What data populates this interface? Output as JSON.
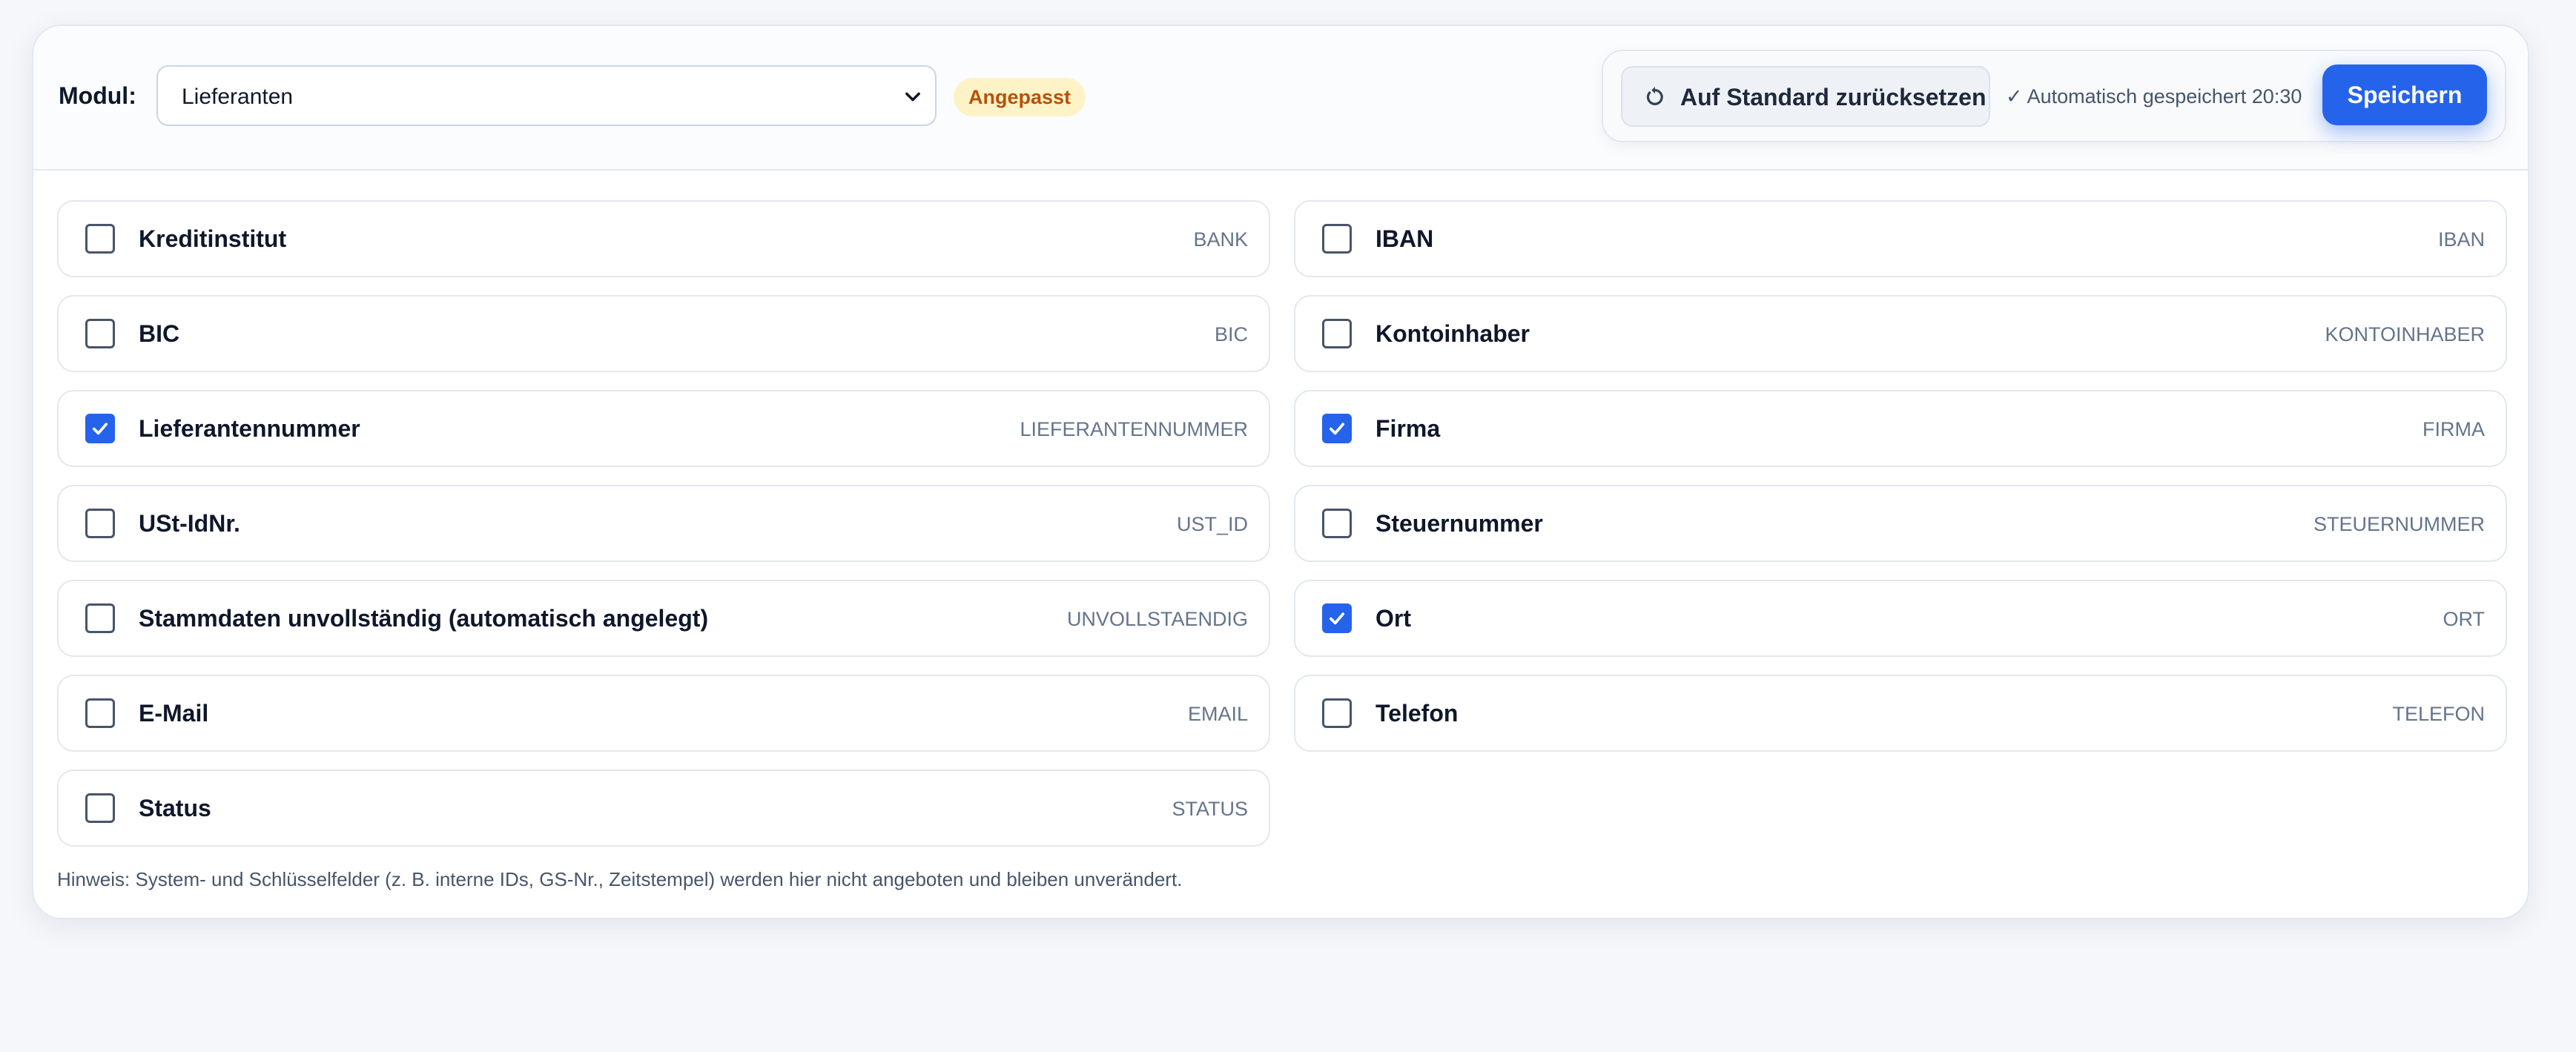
{
  "toolbar": {
    "modul_label": "Modul:",
    "modul_selected": "Lieferanten",
    "badge": "Angepasst",
    "reset_label": "Auf Standard zurücksetzen",
    "autosave_check": "✓",
    "autosave_text": "Automatisch gespeichert 20:30",
    "save_label": "Speichern"
  },
  "fields": [
    {
      "label": "Kreditinstitut",
      "key": "BANK",
      "checked": false
    },
    {
      "label": "IBAN",
      "key": "IBAN",
      "checked": false
    },
    {
      "label": "BIC",
      "key": "BIC",
      "checked": false
    },
    {
      "label": "Kontoinhaber",
      "key": "KONTOINHABER",
      "checked": false
    },
    {
      "label": "Lieferantennummer",
      "key": "LIEFERANTENNUMMER",
      "checked": true
    },
    {
      "label": "Firma",
      "key": "FIRMA",
      "checked": true
    },
    {
      "label": "USt-IdNr.",
      "key": "UST_ID",
      "checked": false
    },
    {
      "label": "Steuernummer",
      "key": "STEUERNUMMER",
      "checked": false
    },
    {
      "label": "Stammdaten unvollständig (automatisch angelegt)",
      "key": "UNVOLLSTAENDIG",
      "checked": false
    },
    {
      "label": "Ort",
      "key": "ORT",
      "checked": true
    },
    {
      "label": "E-Mail",
      "key": "EMAIL",
      "checked": false
    },
    {
      "label": "Telefon",
      "key": "TELEFON",
      "checked": false
    },
    {
      "label": "Status",
      "key": "STATUS",
      "checked": false
    }
  ],
  "hint": "Hinweis: System- und Schlüsselfelder (z. B. interne IDs, GS-Nr., Zeitstempel) werden hier nicht angeboten und bleiben unverändert.",
  "colors": {
    "accent": "#2563eb",
    "badge_bg": "#fef3c7",
    "badge_text": "#b45309"
  },
  "icons": {
    "reset": "reset-icon",
    "dropdown": "chevron-down-icon",
    "check": "check-icon"
  }
}
